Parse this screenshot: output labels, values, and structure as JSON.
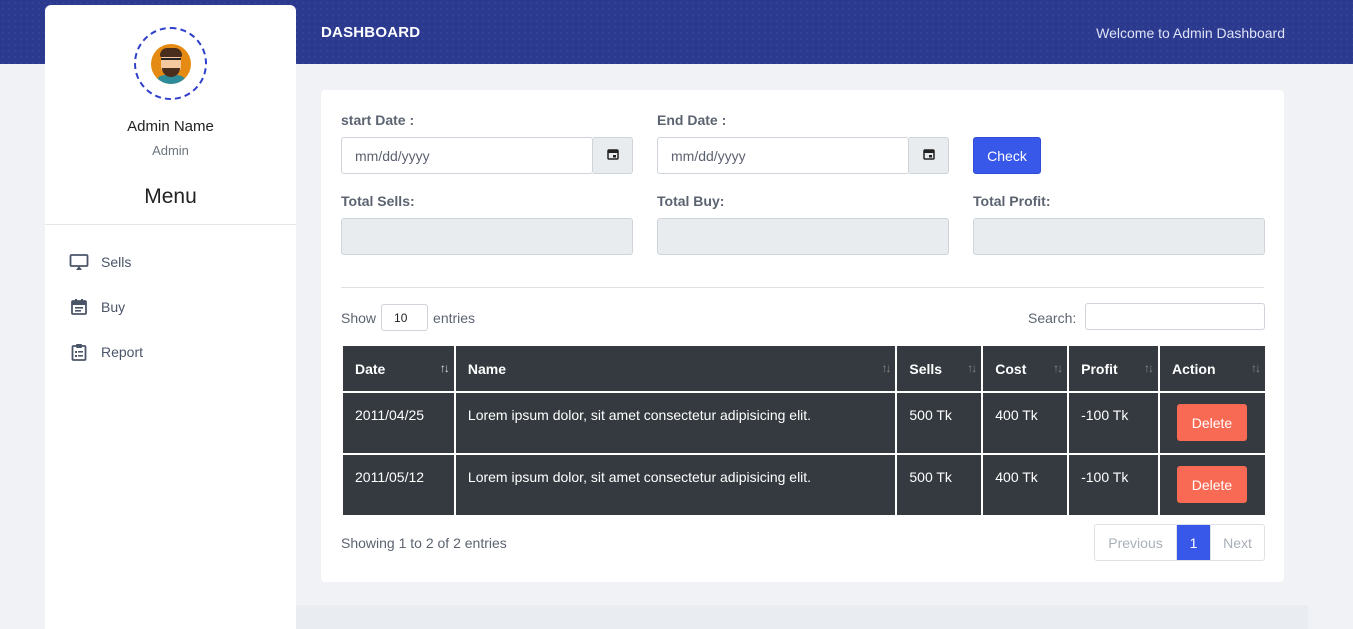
{
  "header": {
    "title": "DASHBOARD",
    "welcome": "Welcome to Admin Dashboard"
  },
  "profile": {
    "name": "Admin Name",
    "role": "Admin"
  },
  "sidebar": {
    "menu_title": "Menu",
    "items": [
      {
        "label": "Sells",
        "icon": "monitor-icon"
      },
      {
        "label": "Buy",
        "icon": "calendar-icon"
      },
      {
        "label": "Report",
        "icon": "clipboard-icon"
      }
    ]
  },
  "filters": {
    "start_label": "start Date :",
    "start_placeholder": "mm/dd/yyyy",
    "end_label": "End Date :",
    "end_placeholder": "mm/dd/yyyy",
    "check_label": "Check",
    "total_sells_label": "Total Sells:",
    "total_buy_label": "Total Buy:",
    "total_profit_label": "Total Profit:"
  },
  "table_controls": {
    "show_label": "Show",
    "entries_value": "10",
    "entries_label": "entries",
    "search_label": "Search:"
  },
  "table": {
    "headers": [
      "Date",
      "Name",
      "Sells",
      "Cost",
      "Profit",
      "Action"
    ],
    "rows": [
      {
        "date": "2011/04/25",
        "name": "Lorem ipsum dolor, sit amet consectetur adipisicing elit.",
        "sells": "500 Tk",
        "cost": "400 Tk",
        "profit": "-100 Tk",
        "action": "Delete"
      },
      {
        "date": "2011/05/12",
        "name": "Lorem ipsum dolor, sit amet consectetur adipisicing elit.",
        "sells": "500 Tk",
        "cost": "400 Tk",
        "profit": "-100 Tk",
        "action": "Delete"
      }
    ]
  },
  "pagination": {
    "info": "Showing 1 to 2 of 2 entries",
    "previous": "Previous",
    "current": "1",
    "next": "Next"
  },
  "colors": {
    "header_bg": "#2b3a8f",
    "accent": "#3858e9",
    "delete": "#f96a54",
    "table_dark": "#343a40"
  }
}
